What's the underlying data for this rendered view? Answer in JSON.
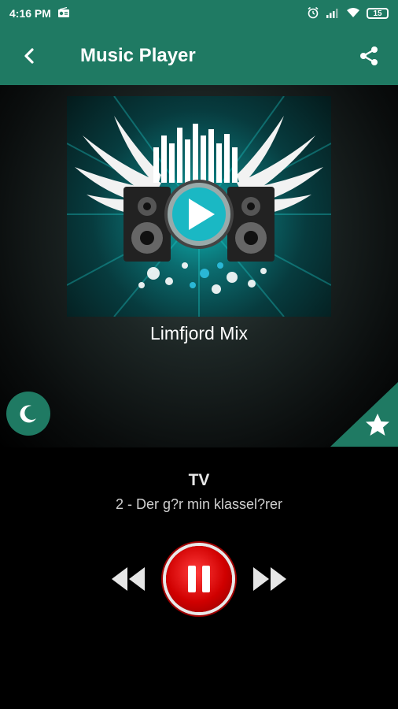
{
  "status_bar": {
    "time": "4:16 PM",
    "battery": "15"
  },
  "app_bar": {
    "title": "Music Player",
    "back_icon": "arrow-left-icon",
    "share_icon": "share-icon"
  },
  "player": {
    "station_name": "Limfjord Mix",
    "artist": "TV",
    "track": "2 - Der g?r min klassel?rer",
    "state": "playing"
  },
  "colors": {
    "accent": "#1f7a63",
    "pause_red": "#d00000"
  }
}
